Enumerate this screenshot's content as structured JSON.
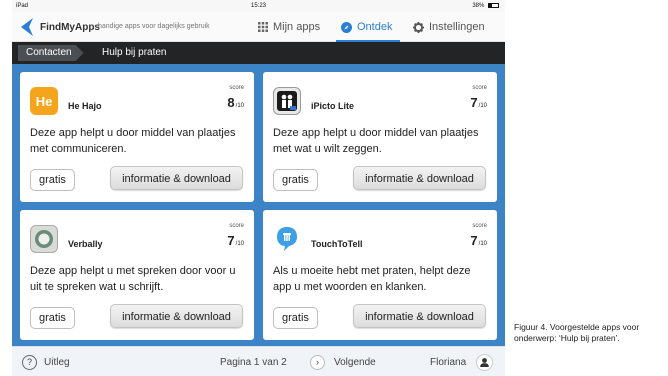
{
  "status_bar": {
    "carrier": "iPad",
    "time": "15:23",
    "battery": "38%"
  },
  "header": {
    "app_name": "FindMyApps",
    "tagline": "handige apps voor dagelijks gebruik",
    "nav": [
      {
        "label": "Mijn apps",
        "icon": "grid-icon"
      },
      {
        "label": "Ontdek",
        "icon": "compass-icon",
        "active": true
      },
      {
        "label": "Instellingen",
        "icon": "gear-icon"
      }
    ]
  },
  "breadcrumb": {
    "back": "Contacten",
    "current": "Hulp bij praten"
  },
  "cards": [
    {
      "name": "He Hajo",
      "icon": "he-hajo-icon",
      "score_label": "score",
      "score": "8",
      "score_max": "/10",
      "description": "Deze app helpt u door middel van plaatjes met communiceren.",
      "price": "gratis",
      "info": "informatie & download"
    },
    {
      "name": "iPicto Lite",
      "icon": "ipicto-icon",
      "score_label": "score",
      "score": "7",
      "score_max": "/10",
      "description": "Deze app helpt u door middel van plaatjes met wat u wilt zeggen.",
      "price": "gratis",
      "info": "informatie & download"
    },
    {
      "name": "Verbally",
      "icon": "verbally-icon",
      "score_label": "score",
      "score": "7",
      "score_max": "/10",
      "description": "Deze app helpt u met spreken door voor u uit te spreken wat u schrijft.",
      "price": "gratis",
      "info": "informatie & download"
    },
    {
      "name": "TouchToTell",
      "icon": "touchtotell-icon",
      "score_label": "score",
      "score": "7",
      "score_max": "/10",
      "description": "Als u moeite hebt met praten, helpt deze app u met woorden en klanken.",
      "price": "gratis",
      "info": "informatie & download"
    }
  ],
  "footer": {
    "help_symbol": "?",
    "help": "Uitleg",
    "page": "Pagina 1 van 2",
    "next_symbol": "›",
    "next": "Volgende",
    "user": "Floriana"
  },
  "caption": "Figuur 4. Voorgestelde apps voor onderwerp: ‘Hulp bij praten’.",
  "colors": {
    "accent": "#2a7fd4",
    "content_bg": "#3d84c6",
    "breadcrumb_bg": "#222426",
    "he_hajo": "#f4a51c"
  }
}
